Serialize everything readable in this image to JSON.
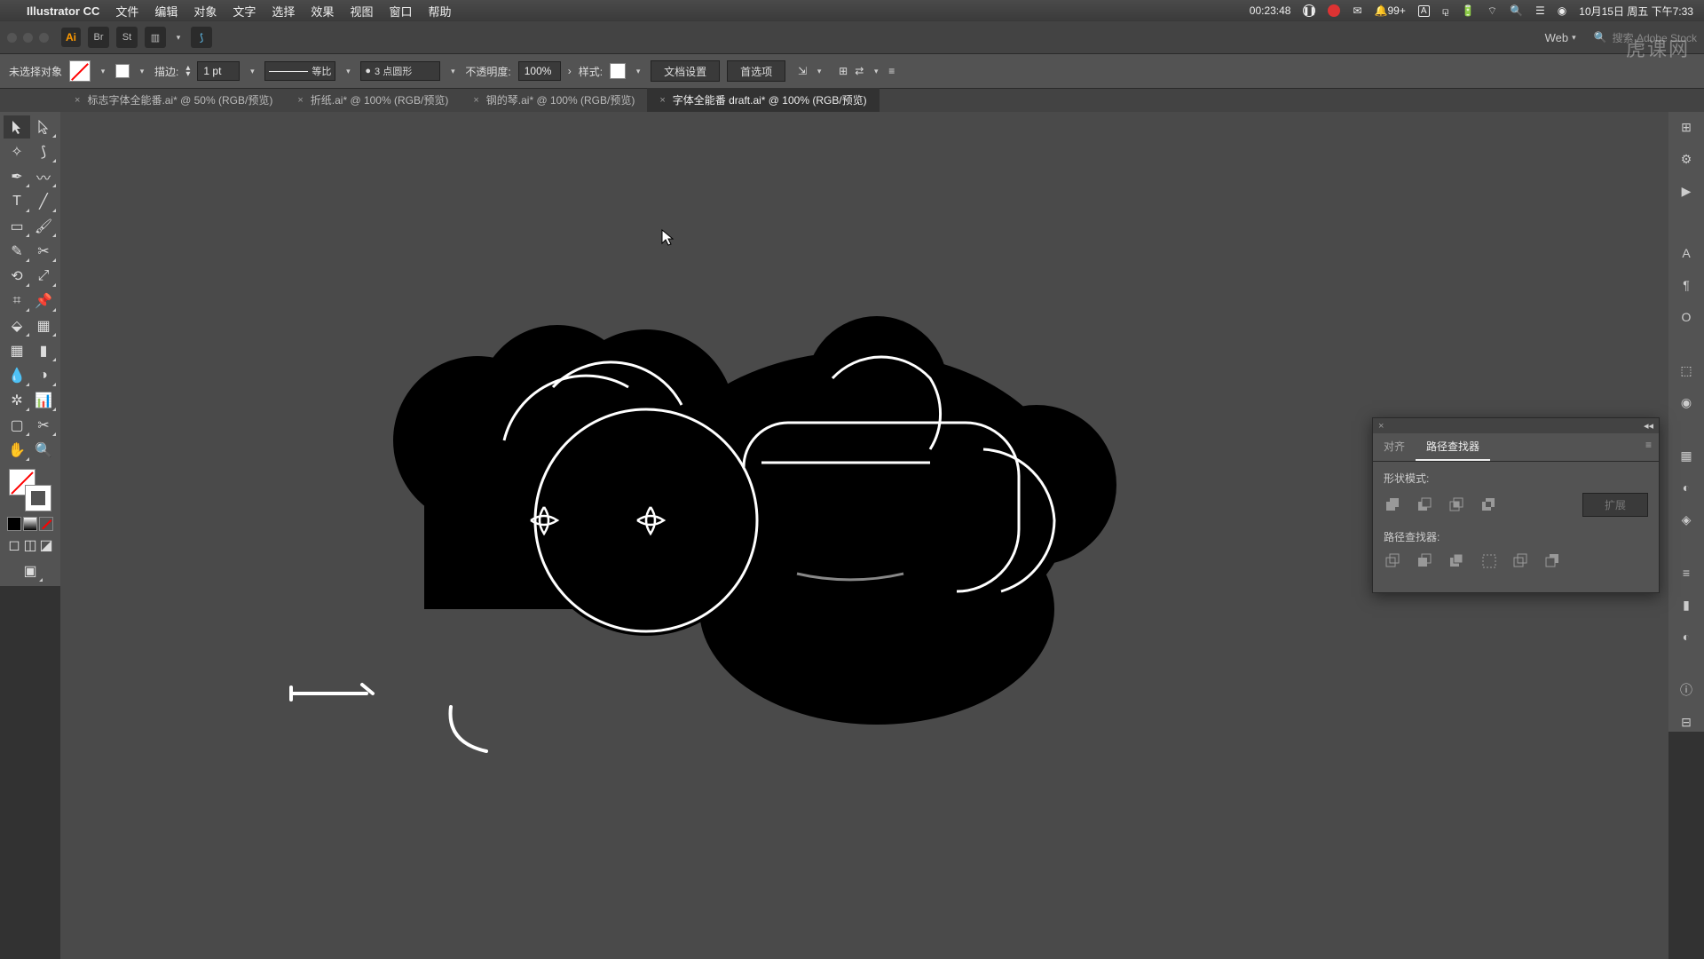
{
  "menubar": {
    "app": "Illustrator CC",
    "items": [
      "文件",
      "编辑",
      "对象",
      "文字",
      "选择",
      "效果",
      "视图",
      "窗口",
      "帮助"
    ],
    "timer": "00:23:48",
    "notif": "99+",
    "date": "10月15日 周五 下午7:33"
  },
  "topbar": {
    "docmode": "Web",
    "search_ph": "搜索 Adobe Stock"
  },
  "controlbar": {
    "selection": "未选择对象",
    "stroke_label": "描边:",
    "stroke_w": "1 pt",
    "dash": "等比",
    "corner": "3 点圆形",
    "opacity_label": "不透明度:",
    "opacity": "100%",
    "style_label": "样式:",
    "docsetup": "文档设置",
    "prefs": "首选项"
  },
  "tabs": [
    {
      "label": "标志字体全能番.ai* @ 50% (RGB/预览)",
      "active": false
    },
    {
      "label": "折纸.ai* @ 100% (RGB/预览)",
      "active": false
    },
    {
      "label": "钢的琴.ai* @ 100% (RGB/预览)",
      "active": false
    },
    {
      "label": "字体全能番 draft.ai* @ 100% (RGB/预览)",
      "active": true
    }
  ],
  "panel": {
    "tab_align": "对齐",
    "tab_pathfinder": "路径查找器",
    "shape_modes": "形状模式:",
    "expand": "扩展",
    "pathfinders": "路径查找器:"
  },
  "watermark": "虎课网"
}
